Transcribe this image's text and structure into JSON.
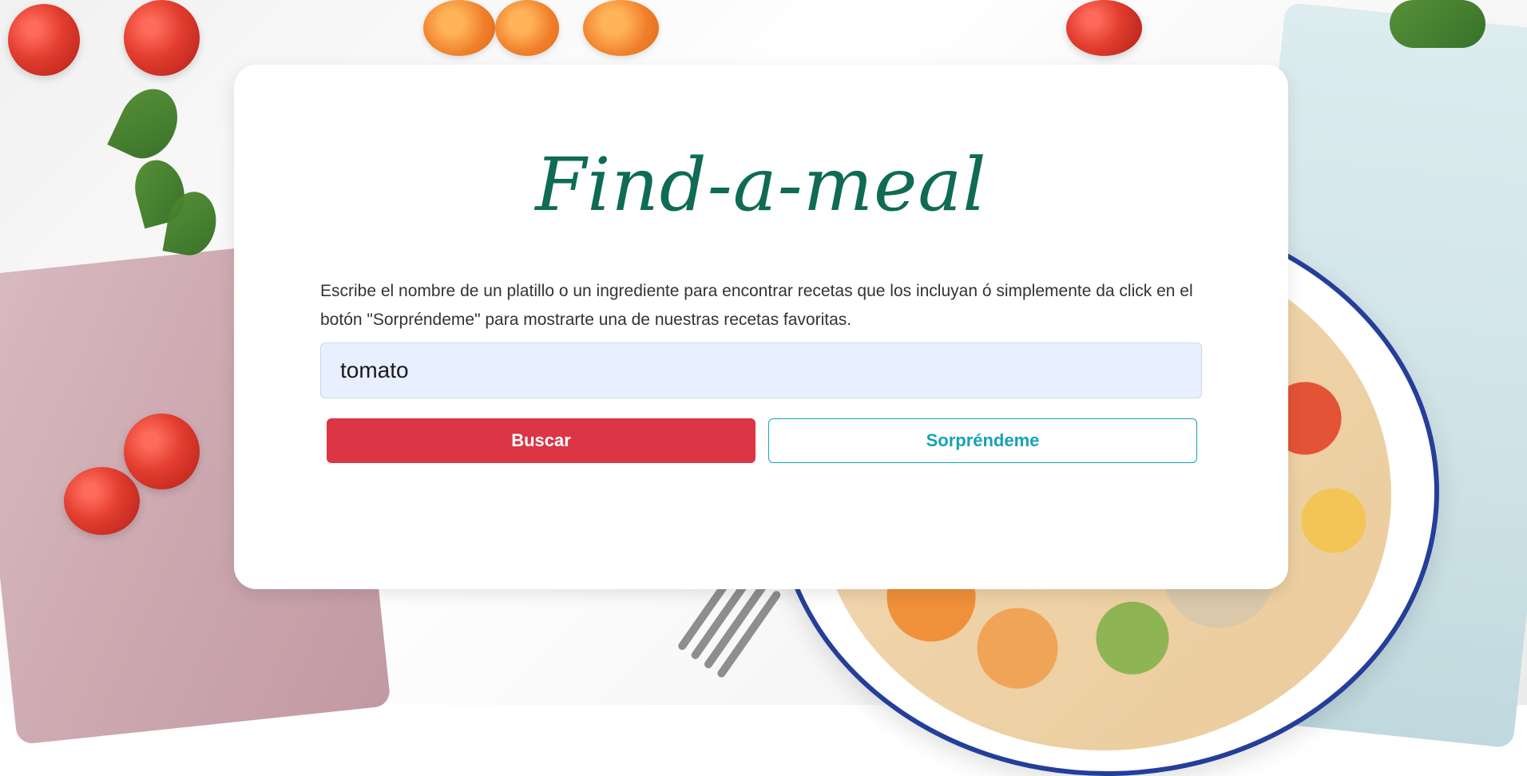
{
  "app": {
    "title": "Find-a-meal",
    "description": "Escribe el nombre de un platillo o un ingrediente para encontrar recetas que los incluyan ó simplemente da click en el botón \"Sorpréndeme\" para mostrarte una de nuestras recetas favoritas.",
    "search": {
      "value": "tomato",
      "placeholder": ""
    },
    "buttons": {
      "search_label": "Buscar",
      "surprise_label": "Sorpréndeme"
    },
    "colors": {
      "title": "#0f6b55",
      "primary": "#dc3545",
      "outline": "#17a2b8",
      "input_bg": "#e8efff"
    },
    "background": {
      "semantic": "food-background-image"
    }
  }
}
